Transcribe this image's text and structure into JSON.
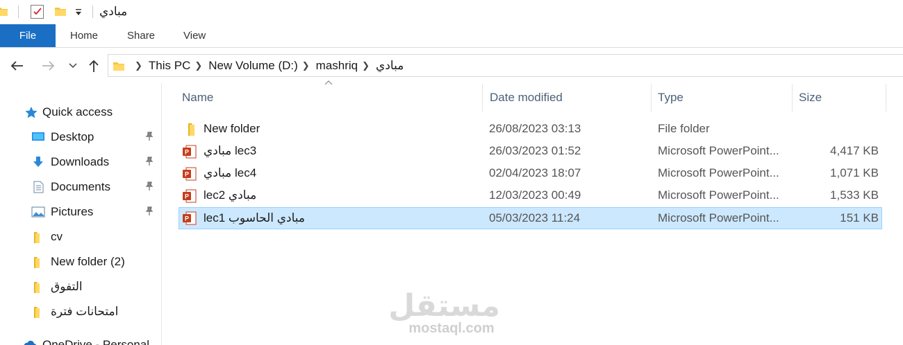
{
  "window": {
    "title": "مبادي"
  },
  "ribbon": {
    "tabs": [
      "File",
      "Home",
      "Share",
      "View"
    ]
  },
  "address": {
    "crumbs": [
      "This PC",
      "New Volume (D:)",
      "mashriq",
      "مبادي"
    ]
  },
  "navpane": {
    "items": [
      {
        "label": "Quick access",
        "icon": "star-icon",
        "pinned": false
      },
      {
        "label": "Desktop",
        "icon": "desktop-icon",
        "pinned": true
      },
      {
        "label": "Downloads",
        "icon": "download-arrow-icon",
        "pinned": true
      },
      {
        "label": "Documents",
        "icon": "document-icon",
        "pinned": true
      },
      {
        "label": "Pictures",
        "icon": "pictures-icon",
        "pinned": true
      },
      {
        "label": "cv",
        "icon": "folder-icon",
        "pinned": false
      },
      {
        "label": "New folder (2)",
        "icon": "folder-icon",
        "pinned": false
      },
      {
        "label": "التفوق",
        "icon": "folder-icon",
        "pinned": false
      },
      {
        "label": "امتحانات فترة",
        "icon": "folder-icon",
        "pinned": false
      },
      {
        "label": "OneDrive - Personal",
        "icon": "cloud-icon",
        "pinned": false
      }
    ]
  },
  "columns": {
    "name": "Name",
    "date": "Date modified",
    "type": "Type",
    "size": "Size"
  },
  "files": [
    {
      "name": "New folder",
      "date": "26/08/2023 03:13",
      "type": "File folder",
      "size": "",
      "icon": "folder-icon",
      "selected": false
    },
    {
      "name": "lec3 مبادي",
      "date": "26/03/2023 01:52",
      "type": "Microsoft PowerPoint...",
      "size": "4,417 KB",
      "icon": "powerpoint-icon",
      "selected": false
    },
    {
      "name": "lec4 مبادي",
      "date": "02/04/2023 18:07",
      "type": "Microsoft PowerPoint...",
      "size": "1,071 KB",
      "icon": "powerpoint-icon",
      "selected": false
    },
    {
      "name": "مبادي lec2",
      "date": "12/03/2023 00:49",
      "type": "Microsoft PowerPoint...",
      "size": "1,533 KB",
      "icon": "powerpoint-icon",
      "selected": false
    },
    {
      "name": "مبادي الحاسوب lec1",
      "date": "05/03/2023 11:24",
      "type": "Microsoft PowerPoint...",
      "size": "151 KB",
      "icon": "powerpoint-icon",
      "selected": true
    }
  ],
  "watermark": {
    "arabic": "مستقل",
    "latin": "mostaql.com"
  },
  "colors": {
    "file_tab": "#1a6fc4",
    "selection": "#cce8ff",
    "folder": "#f4c542",
    "powerpoint": "#c43e1c"
  }
}
